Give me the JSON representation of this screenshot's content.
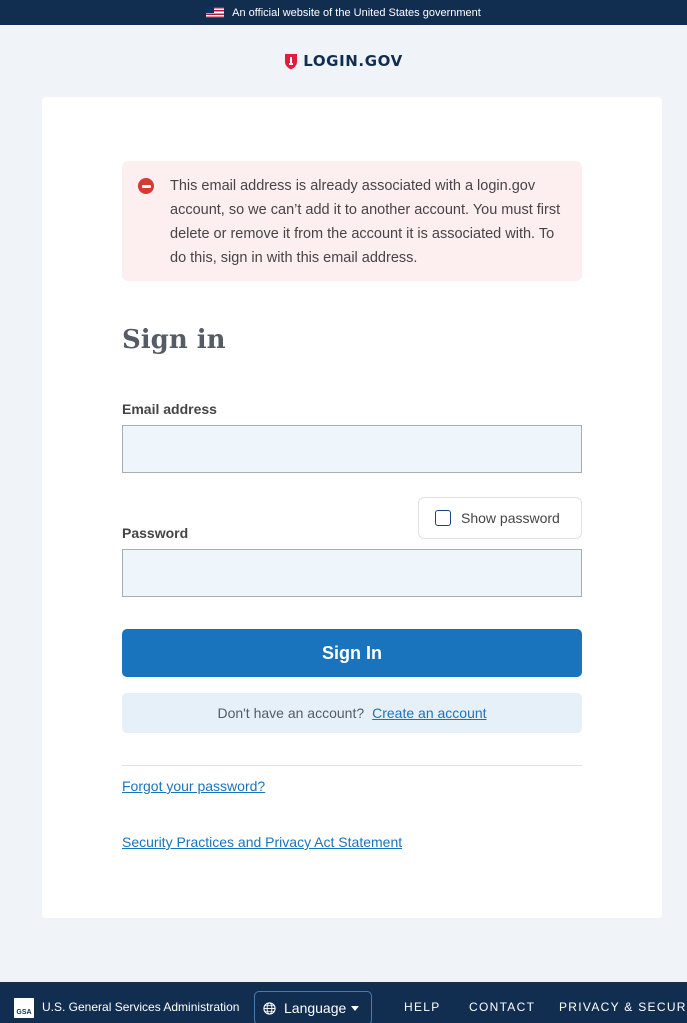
{
  "gov_banner": {
    "text": "An official website of the United States government"
  },
  "logo": {
    "text": "LOGIN.GOV"
  },
  "alert": {
    "message": "This email address is already associated with a login.gov account, so we can’t add it to another account. You must first delete or remove it from the account it is associated with. To do this, sign in with this email address."
  },
  "form": {
    "heading": "Sign in",
    "email_label": "Email address",
    "email_value": "",
    "password_label": "Password",
    "password_value": "",
    "show_password_label": "Show password",
    "submit_label": "Sign In",
    "no_account_text": "Don't have an account?",
    "create_account_link": "Create an account",
    "forgot_password_link": "Forgot your password?",
    "security_link": "Security Practices and Privacy Act Statement"
  },
  "footer": {
    "gsa_logo_text": "GSA",
    "agency": "U.S. General Services Administration",
    "language_label": "Language",
    "links": [
      "HELP",
      "CONTACT",
      "PRIVACY & SECURITY"
    ]
  },
  "colors": {
    "brand_navy": "#112e51",
    "primary_blue": "#1a74bd",
    "error_red": "#d83933",
    "alert_bg": "#fdeef0"
  },
  "icons": [
    "us-flag-icon",
    "shield-logo-icon",
    "error-icon",
    "checkbox-icon",
    "gsa-logo-icon",
    "globe-icon",
    "caret-down-icon"
  ]
}
